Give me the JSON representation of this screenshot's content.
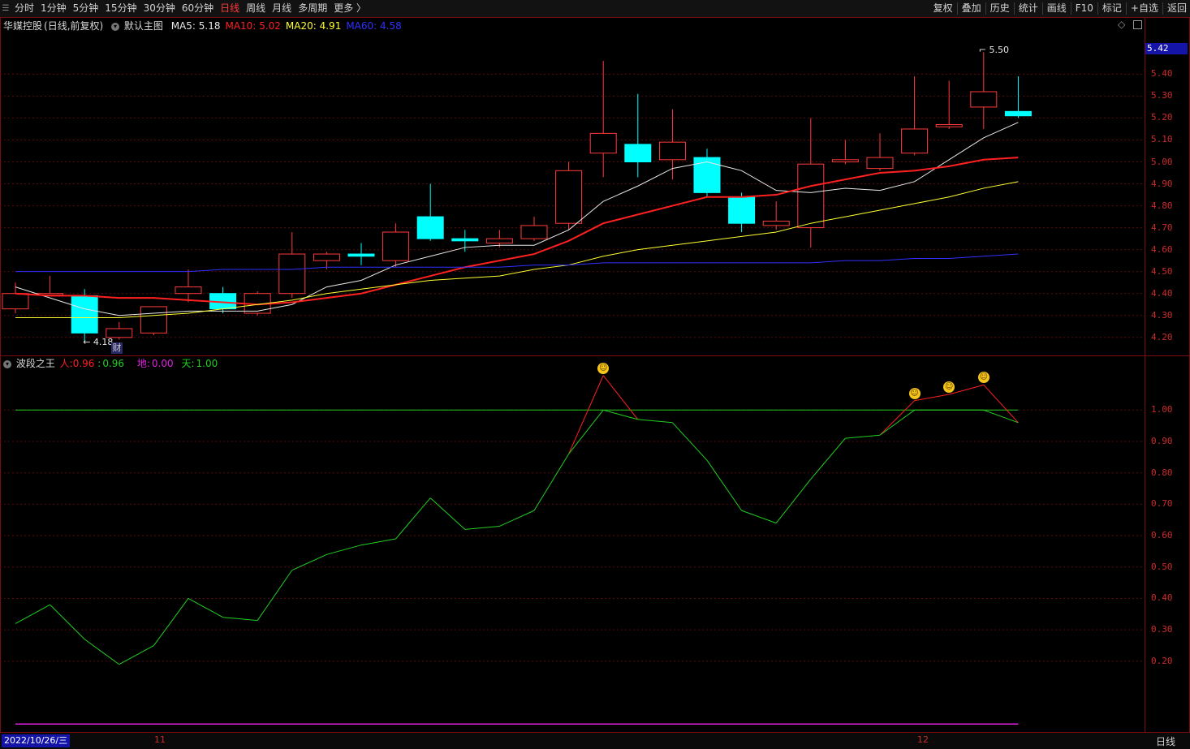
{
  "toolbar": {
    "left_items": [
      "分时",
      "1分钟",
      "5分钟",
      "15分钟",
      "30分钟",
      "60分钟",
      "日线",
      "周线",
      "月线",
      "多周期",
      "更多 〉"
    ],
    "active": "日线",
    "right_items": [
      "复权",
      "叠加",
      "历史",
      "统计",
      "画线",
      "F10",
      "标记",
      "+自选",
      "返回"
    ]
  },
  "main": {
    "stock": "华媒控股",
    "mode": "(日线,前复权)",
    "template": "默认主图",
    "ma": [
      {
        "name": "MA5",
        "value": "5.18",
        "color": "#e8e8e8"
      },
      {
        "name": "MA10",
        "value": "5.02",
        "color": "#ff2020"
      },
      {
        "name": "MA20",
        "value": "4.91",
        "color": "#ffff30"
      },
      {
        "name": "MA60",
        "value": "4.58",
        "color": "#3030ff"
      }
    ],
    "price_badge": "5.42",
    "high_mark": "5.50",
    "low_mark": "4.18",
    "cai_badge": "财",
    "yaxis": [
      "5.40",
      "5.30",
      "5.20",
      "5.10",
      "5.00",
      "4.90",
      "4.80",
      "4.70",
      "4.60",
      "4.50",
      "4.40",
      "4.30",
      "4.20"
    ],
    "ylim": [
      4.14,
      5.59
    ]
  },
  "indicator": {
    "name": "波段之王",
    "ren_label": "人:",
    "ren_value": "0.96",
    "sep": ":",
    "ren_value2": "0.96",
    "di_label": "地:",
    "di_value": "0.00",
    "tian_label": "天:",
    "tian_value": "1.00",
    "yaxis": [
      "1.00",
      "0.90",
      "0.80",
      "0.70",
      "0.60",
      "0.50",
      "0.40",
      "0.30",
      "0.20"
    ],
    "ylim": [
      -0.02,
      1.13
    ]
  },
  "dateaxis": {
    "date": "2022/10/26/三",
    "ticks": [
      "11",
      "12"
    ],
    "period": "日线"
  },
  "chart_data": [
    {
      "type": "candlestick",
      "title": "华媒控股 (日线,前复权)",
      "ylim": [
        4.14,
        5.59
      ],
      "up_color": "#ff3a3a",
      "down_color": "#00ffff",
      "candles": [
        {
          "o": 4.33,
          "h": 4.45,
          "l": 4.31,
          "c": 4.4
        },
        {
          "o": 4.4,
          "h": 4.48,
          "l": 4.39,
          "c": 4.4
        },
        {
          "o": 4.39,
          "h": 4.42,
          "l": 4.18,
          "c": 4.22
        },
        {
          "o": 4.2,
          "h": 4.27,
          "l": 4.19,
          "c": 4.24
        },
        {
          "o": 4.22,
          "h": 4.34,
          "l": 4.21,
          "c": 4.34
        },
        {
          "o": 4.4,
          "h": 4.51,
          "l": 4.36,
          "c": 4.43
        },
        {
          "o": 4.4,
          "h": 4.43,
          "l": 4.31,
          "c": 4.33
        },
        {
          "o": 4.31,
          "h": 4.41,
          "l": 4.3,
          "c": 4.4
        },
        {
          "o": 4.4,
          "h": 4.68,
          "l": 4.38,
          "c": 4.58
        },
        {
          "o": 4.55,
          "h": 4.59,
          "l": 4.51,
          "c": 4.58
        },
        {
          "o": 4.58,
          "h": 4.63,
          "l": 4.53,
          "c": 4.57
        },
        {
          "o": 4.55,
          "h": 4.72,
          "l": 4.52,
          "c": 4.68
        },
        {
          "o": 4.75,
          "h": 4.9,
          "l": 4.64,
          "c": 4.65
        },
        {
          "o": 4.65,
          "h": 4.69,
          "l": 4.59,
          "c": 4.64
        },
        {
          "o": 4.63,
          "h": 4.69,
          "l": 4.61,
          "c": 4.65
        },
        {
          "o": 4.65,
          "h": 4.75,
          "l": 4.64,
          "c": 4.71
        },
        {
          "o": 4.72,
          "h": 5.0,
          "l": 4.69,
          "c": 4.96
        },
        {
          "o": 5.04,
          "h": 5.46,
          "l": 4.93,
          "c": 5.13
        },
        {
          "o": 5.08,
          "h": 5.31,
          "l": 4.93,
          "c": 5.0
        },
        {
          "o": 5.01,
          "h": 5.24,
          "l": 4.92,
          "c": 5.09
        },
        {
          "o": 5.02,
          "h": 5.06,
          "l": 4.84,
          "c": 4.86
        },
        {
          "o": 4.84,
          "h": 4.86,
          "l": 4.68,
          "c": 4.72
        },
        {
          "o": 4.71,
          "h": 4.82,
          "l": 4.69,
          "c": 4.73
        },
        {
          "o": 4.7,
          "h": 5.2,
          "l": 4.61,
          "c": 4.99
        },
        {
          "o": 5.0,
          "h": 5.1,
          "l": 4.99,
          "c": 5.01
        },
        {
          "o": 4.97,
          "h": 5.13,
          "l": 4.96,
          "c": 5.02
        },
        {
          "o": 5.04,
          "h": 5.39,
          "l": 5.03,
          "c": 5.15
        },
        {
          "o": 5.16,
          "h": 5.37,
          "l": 5.15,
          "c": 5.17
        },
        {
          "o": 5.25,
          "h": 5.5,
          "l": 5.15,
          "c": 5.32
        },
        {
          "o": 5.23,
          "h": 5.39,
          "l": 5.2,
          "c": 5.21
        }
      ],
      "series": [
        {
          "name": "MA5",
          "color": "#e8e8e8",
          "values": [
            4.43,
            4.38,
            4.33,
            4.3,
            4.31,
            4.32,
            4.32,
            4.32,
            4.35,
            4.43,
            4.46,
            4.53,
            4.57,
            4.61,
            4.62,
            4.62,
            4.69,
            4.82,
            4.89,
            4.97,
            5.0,
            4.96,
            4.87,
            4.86,
            4.88,
            4.87,
            4.91,
            5.01,
            5.11,
            5.18
          ]
        },
        {
          "name": "MA10",
          "color": "#ff2020",
          "values": [
            4.4,
            4.39,
            4.39,
            4.38,
            4.38,
            4.37,
            4.36,
            4.35,
            4.36,
            4.38,
            4.4,
            4.44,
            4.48,
            4.52,
            4.55,
            4.58,
            4.64,
            4.72,
            4.76,
            4.8,
            4.84,
            4.84,
            4.85,
            4.89,
            4.92,
            4.95,
            4.96,
            4.98,
            5.01,
            5.02
          ]
        },
        {
          "name": "MA20",
          "color": "#ffff30",
          "values": [
            4.29,
            4.29,
            4.29,
            4.29,
            4.3,
            4.31,
            4.33,
            4.35,
            4.37,
            4.4,
            4.42,
            4.44,
            4.46,
            4.47,
            4.48,
            4.51,
            4.53,
            4.57,
            4.6,
            4.62,
            4.64,
            4.66,
            4.68,
            4.72,
            4.75,
            4.78,
            4.81,
            4.84,
            4.88,
            4.91
          ]
        },
        {
          "name": "MA60",
          "color": "#3030ff",
          "values": [
            4.5,
            4.5,
            4.5,
            4.5,
            4.5,
            4.5,
            4.51,
            4.51,
            4.51,
            4.52,
            4.52,
            4.52,
            4.52,
            4.52,
            4.52,
            4.53,
            4.53,
            4.54,
            4.54,
            4.54,
            4.54,
            4.54,
            4.54,
            4.54,
            4.55,
            4.55,
            4.56,
            4.56,
            4.57,
            4.58
          ]
        }
      ]
    },
    {
      "type": "line",
      "title": "波段之王",
      "ylim": [
        -0.02,
        1.13
      ],
      "series": [
        {
          "name": "人",
          "color": "#ff2020",
          "values": [
            0.32,
            0.38,
            0.27,
            0.19,
            0.25,
            0.4,
            0.34,
            0.33,
            0.49,
            0.54,
            0.57,
            0.59,
            0.72,
            0.62,
            0.63,
            0.68,
            0.86,
            1.11,
            0.97,
            0.96,
            0.84,
            0.68,
            0.64,
            0.78,
            0.91,
            0.92,
            1.03,
            1.05,
            1.08,
            0.96
          ]
        },
        {
          "name": "地",
          "color": "#e020e0",
          "values": [
            0,
            0,
            0,
            0,
            0,
            0,
            0,
            0,
            0,
            0,
            0,
            0,
            0,
            0,
            0,
            0,
            0,
            0,
            0,
            0,
            0,
            0,
            0,
            0,
            0,
            0,
            0,
            0,
            0,
            0
          ]
        },
        {
          "name": "天",
          "color": "#20d020",
          "values": [
            1,
            1,
            1,
            1,
            1,
            1,
            1,
            1,
            1,
            1,
            1,
            1,
            1,
            1,
            1,
            1,
            1,
            1,
            1,
            1,
            1,
            1,
            1,
            1,
            1,
            1,
            1,
            1,
            1,
            1
          ]
        }
      ],
      "markers": [
        17,
        26,
        27,
        28
      ]
    }
  ]
}
